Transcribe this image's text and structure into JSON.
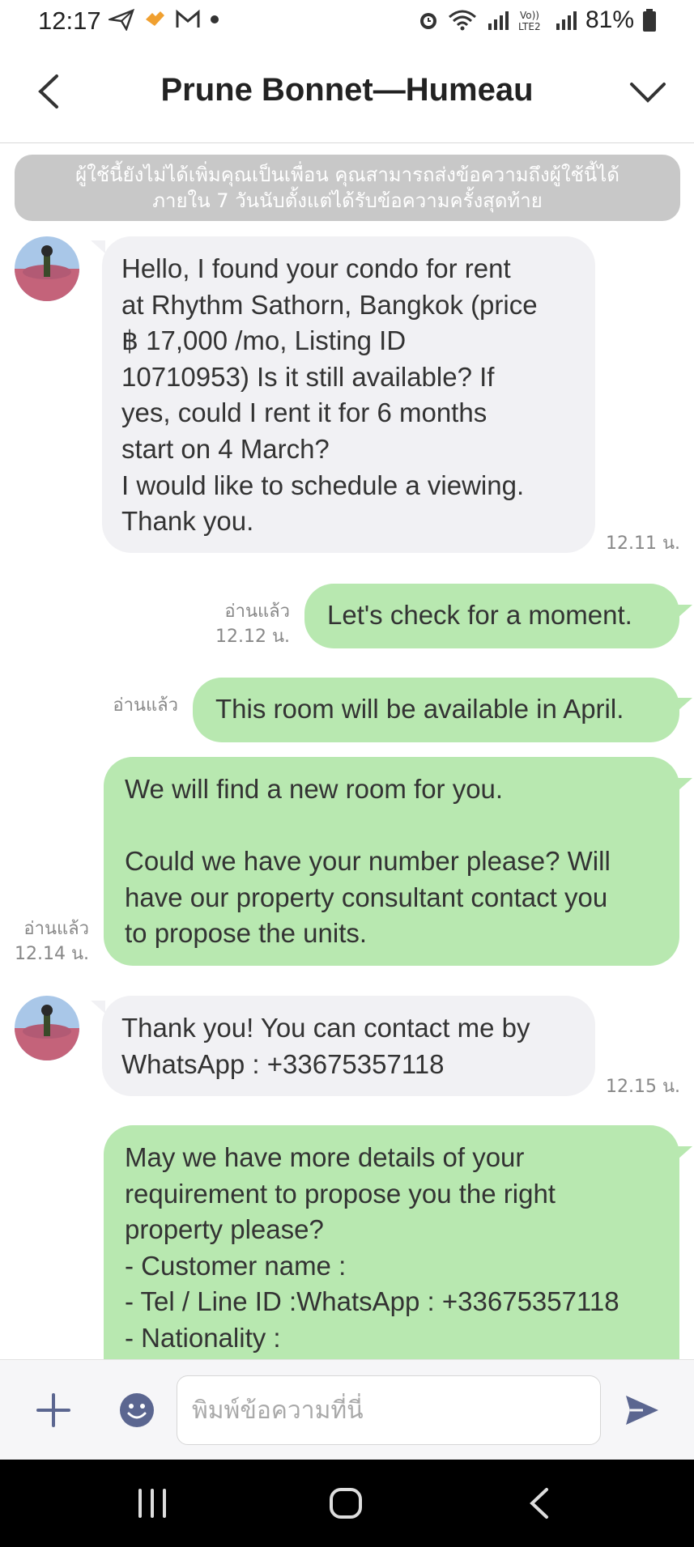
{
  "status_bar": {
    "time": "12:17",
    "battery": "81%",
    "left_icons": [
      "send-arrow-icon",
      "app-heart-icon",
      "gmail-icon",
      "dot-icon"
    ],
    "right_icons": [
      "alarm-icon",
      "wifi-icon",
      "signal-icon",
      "volte-lte2-icon",
      "signal-icon",
      "battery-icon"
    ]
  },
  "header": {
    "title": "Prune Bonnet—Humeau",
    "back_icon": "chevron-left-icon",
    "menu_icon": "chevron-down-icon"
  },
  "notice": {
    "line1": "ผู้ใช้นี้ยังไม่ได้เพิ่มคุณเป็นเพื่อน คุณสามารถส่งข้อความถึงผู้ใช้นี้ได้",
    "line2": "ภายใน 7 วันนับตั้งแต่ได้รับข้อความครั้งสุดท้าย"
  },
  "messages": [
    {
      "direction": "incoming",
      "text": "Hello, I found your condo for rent\nat Rhythm Sathorn, Bangkok (price\n฿ 17,000 /mo, Listing ID\n10710953) Is it still available? If\nyes, could I rent it for 6 months\nstart on 4 March?\nI would like to schedule a viewing.\nThank you.",
      "time": "12.11 น."
    },
    {
      "direction": "outgoing",
      "text": "Let's check for a moment.",
      "read": "อ่านแล้ว",
      "time": "12.12 น."
    },
    {
      "direction": "outgoing",
      "text": "This room will be available in April.",
      "read": "อ่านแล้ว",
      "time": ""
    },
    {
      "direction": "outgoing",
      "text": "We will find a new room for you.\n\nCould we have your number please? Will\nhave our property consultant contact you\nto propose the units.",
      "read": "อ่านแล้ว",
      "time": "12.14 น."
    },
    {
      "direction": "incoming",
      "text": "Thank you! You can contact me by\nWhatsApp : +33675357118",
      "time": "12.15 น."
    },
    {
      "direction": "outgoing",
      "text": "May we have more details of your\nrequirement to propose you the right\nproperty please?\n- Customer name :\n- Tel / Line ID :WhatsApp : +33675357118\n- Nationality :",
      "read": "",
      "time": ""
    }
  ],
  "input_bar": {
    "placeholder": "พิมพ์ข้อความที่นี่",
    "value": "",
    "icons": [
      "plus-icon",
      "emoji-icon",
      "send-icon"
    ]
  },
  "nav_bar": {
    "icons": [
      "recent-apps-icon",
      "home-icon",
      "back-icon"
    ]
  },
  "colors": {
    "incoming_bubble": "#f1f1f4",
    "outgoing_bubble": "#b8e8b0",
    "notice_bg": "#c8c8c8",
    "icon_accent": "#5b6690"
  }
}
